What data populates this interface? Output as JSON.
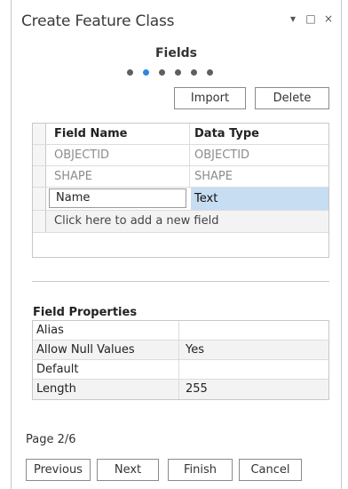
{
  "window": {
    "title": "Create Feature Class",
    "controls": {
      "pin": "▾",
      "maximize": "□",
      "close": "×"
    }
  },
  "step": {
    "title": "Fields",
    "total_steps": 6,
    "current_step": 2
  },
  "toolbar": {
    "import_label": "Import",
    "delete_label": "Delete"
  },
  "fields_table": {
    "headers": [
      "Field Name",
      "Data Type"
    ],
    "rows": [
      {
        "name": "OBJECTID",
        "type": "OBJECTID",
        "readonly": true
      },
      {
        "name": "SHAPE",
        "type": "SHAPE",
        "readonly": true
      },
      {
        "name": "Name",
        "type": "Text",
        "readonly": false,
        "selected": true
      }
    ],
    "add_row_text": "Click here to add a new field"
  },
  "field_properties": {
    "label": "Field Properties",
    "rows": [
      {
        "key": "Alias",
        "value": ""
      },
      {
        "key": "Allow Null Values",
        "value": "Yes"
      },
      {
        "key": "Default",
        "value": ""
      },
      {
        "key": "Length",
        "value": "255"
      }
    ]
  },
  "footer": {
    "page_indicator": "Page 2/6",
    "previous_label": "Previous",
    "next_label": "Next",
    "finish_label": "Finish",
    "cancel_label": "Cancel"
  },
  "colors": {
    "accent": "#2e86de",
    "selection": "#c7ddf2",
    "dot": "#5f5f5f"
  }
}
